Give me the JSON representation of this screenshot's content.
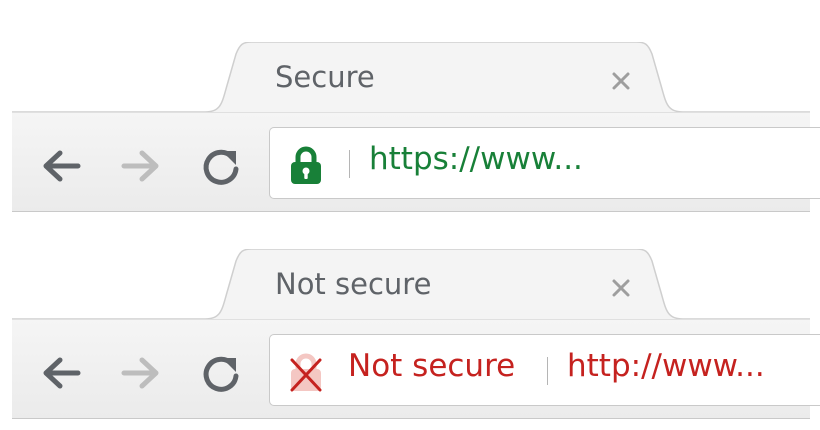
{
  "windows": [
    {
      "tab": {
        "title": "Secure",
        "close_icon": "close-icon"
      },
      "toolbar": {
        "back_icon": "arrow-left-icon",
        "forward_icon": "arrow-right-icon",
        "reload_icon": "reload-icon"
      },
      "omnibox": {
        "security_icon": "lock-icon",
        "security_color": "#188038",
        "url": "https://www..."
      }
    },
    {
      "tab": {
        "title": "Not secure",
        "close_icon": "close-icon"
      },
      "toolbar": {
        "back_icon": "arrow-left-icon",
        "forward_icon": "arrow-right-icon",
        "reload_icon": "reload-icon"
      },
      "omnibox": {
        "security_icon": "not-secure-icon",
        "security_label": "Not secure",
        "security_color": "#c5221f",
        "url": "http://www..."
      }
    }
  ]
}
